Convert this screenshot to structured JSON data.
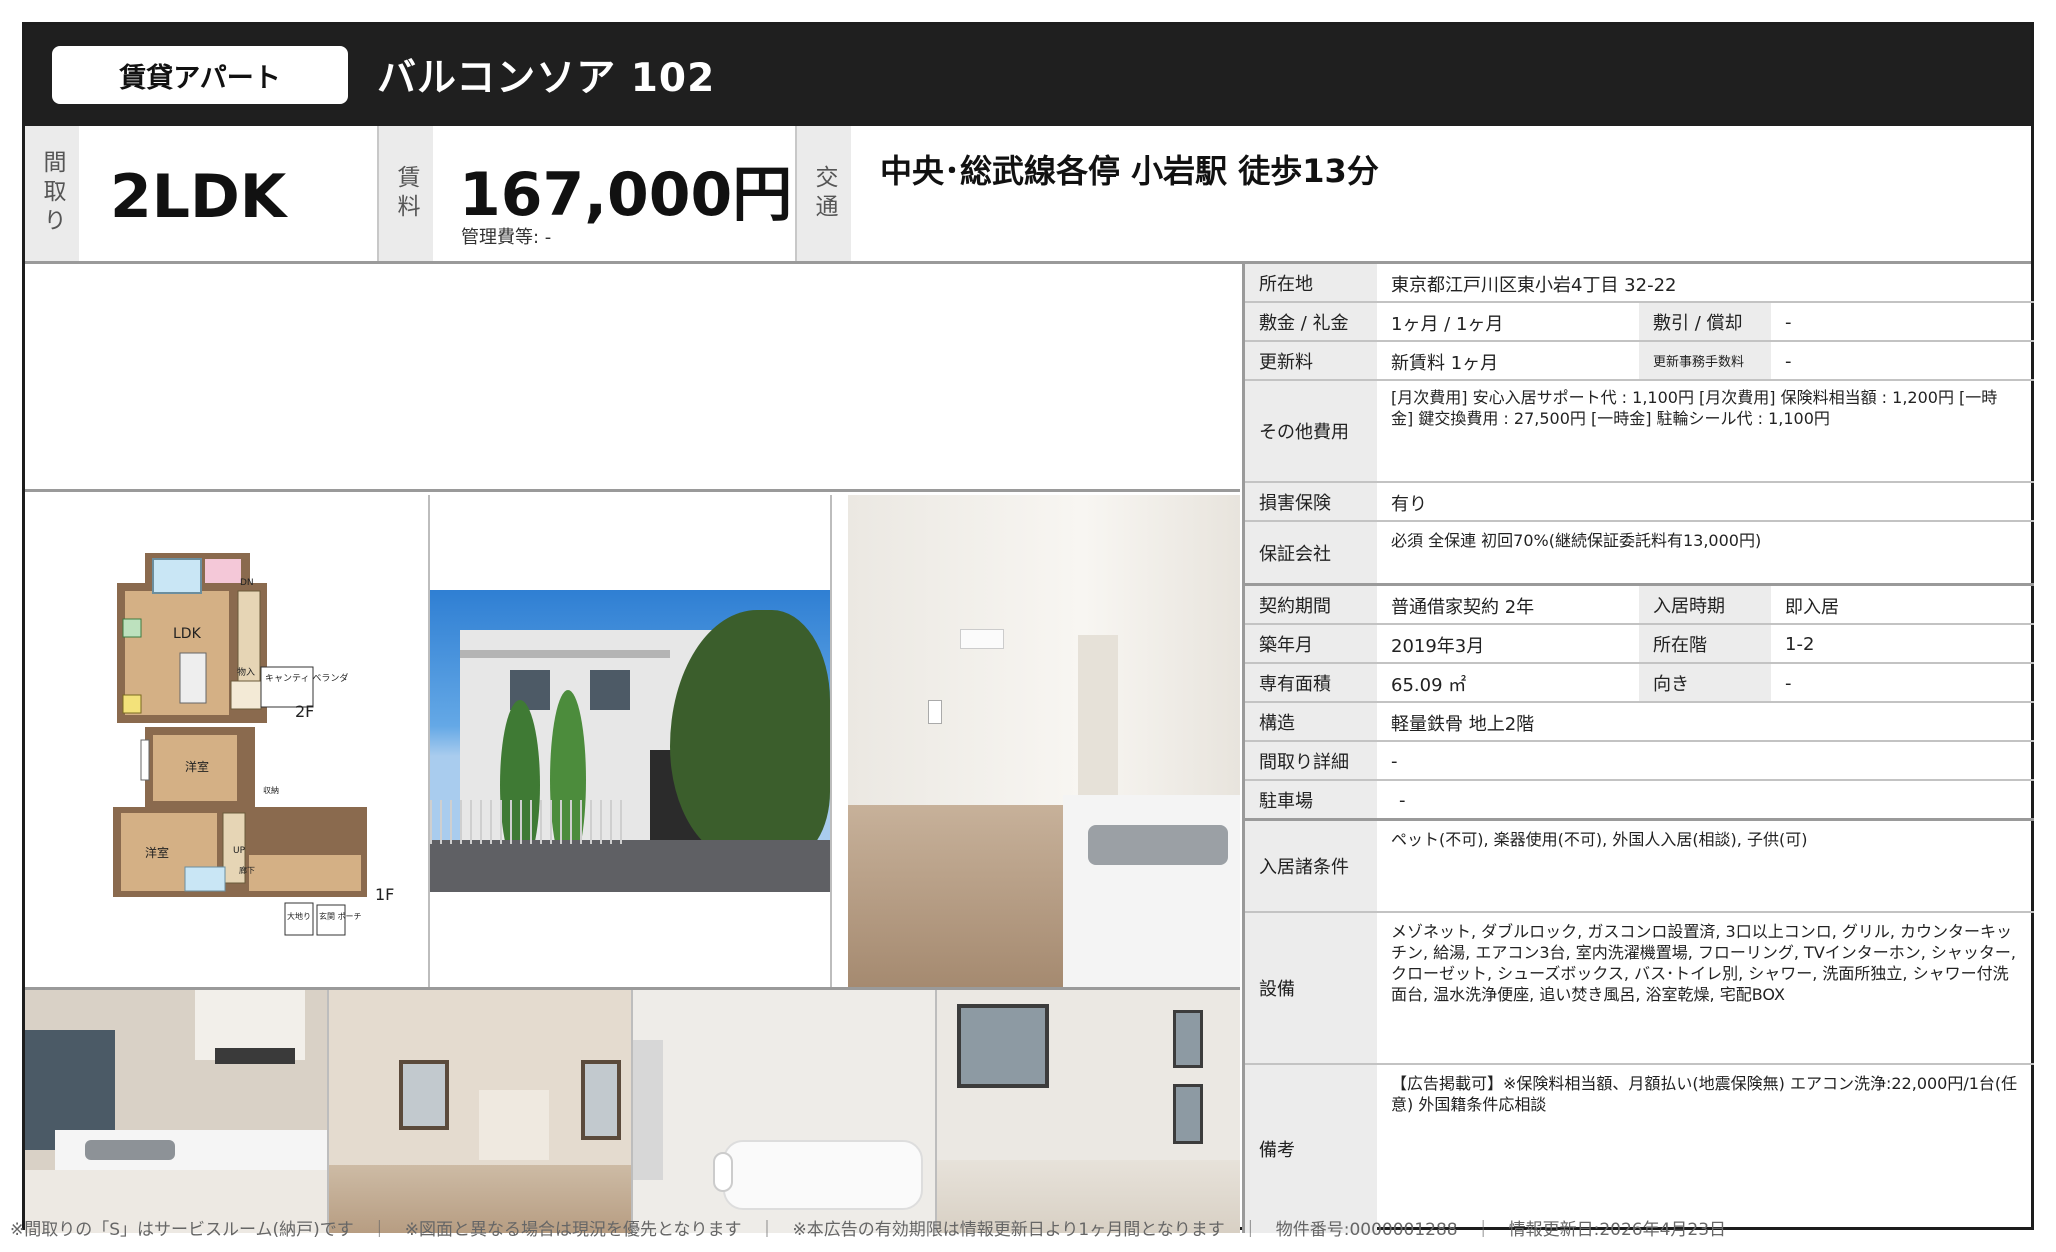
{
  "header": {
    "property_type": "賃貸アパート",
    "property_name": "バルコンソア 102"
  },
  "key_info": {
    "layout_label": "間取り",
    "layout_value": "2LDK",
    "rent_label": "賃料",
    "rent_value": "167,000円",
    "management_fee": "管理費等: -",
    "access_label": "交通",
    "access_value": "中央･総武線各停 小岩駅 徒歩13分"
  },
  "floor_plan": {
    "ldk": "LDK",
    "room_1": "洋室",
    "room_2": "洋室",
    "floor_2": "2F",
    "floor_1": "1F",
    "balcony": "キャンティ ベランダ",
    "storage": "物入",
    "closet": "収納",
    "hall": "廊下",
    "up": "UP",
    "dn": "DN",
    "entrance": "玄関 ポーチ",
    "porch": "大地り"
  },
  "details": {
    "address_label": "所在地",
    "address_value": "東京都江戸川区東小岩4丁目 32-22",
    "deposit_label": "敷金 / 礼金",
    "deposit_value": "1ヶ月 / 1ヶ月",
    "deduction_label": "敷引 / 償却",
    "deduction_value": "-",
    "renewal_label": "更新料",
    "renewal_value": "新賃料 1ヶ月",
    "renewal_fee_label": "更新事務手数料",
    "renewal_fee_value": "-",
    "other_fees_label": "その他費用",
    "other_fees_value": "[月次費用] 安心入居サポート代 : 1,100円 [月次費用] 保険料相当額 : 1,200円 [一時金] 鍵交換費用 : 27,500円 [一時金] 駐輪シール代 : 1,100円",
    "insurance_label": "損害保険",
    "insurance_value": "有り",
    "guarantor_label": "保証会社",
    "guarantor_value": "必須 全保連 初回70%(継続保証委託料有13,000円)",
    "contract_label": "契約期間",
    "contract_value": "普通借家契約 2年",
    "move_in_label": "入居時期",
    "move_in_value": "即入居",
    "built_label": "築年月",
    "built_value": "2019年3月",
    "floor_label": "所在階",
    "floor_value": "1-2",
    "area_label": "専有面積",
    "area_value": "65.09 ㎡",
    "direction_label": "向き",
    "direction_value": "-",
    "structure_label": "構造",
    "structure_value": "軽量鉄骨 地上2階",
    "layout_detail_label": "間取り詳細",
    "layout_detail_value": "-",
    "parking_label": "駐車場",
    "parking_value": "-",
    "conditions_label": "入居諸条件",
    "conditions_value": "ペット(不可), 楽器使用(不可), 外国人入居(相談), 子供(可)",
    "equipment_label": "設備",
    "equipment_value": "メゾネット, ダブルロック, ガスコンロ設置済, 3口以上コンロ, グリル, カウンターキッチン, 給湯, エアコン3台, 室内洗濯機置場, フローリング, TVインターホン, シャッター, クローゼット, シューズボックス, バス･トイレ別, シャワー, 洗面所独立, シャワー付洗面台, 温水洗浄便座, 追い焚き風呂, 浴室乾燥, 宅配BOX",
    "remarks_label": "備考",
    "remarks_value": "【広告掲載可】※保険料相当額、月額払い(地震保険無) エアコン洗浄:22,000円/1台(任意) 外国籍条件応相談"
  },
  "footer": {
    "text": "※間取りの「S」はサービスルーム(納戸)です　｜　※図面と異なる場合は現況を優先となります　｜　※本広告の有効期限は情報更新日より1ヶ月間となります　｜　物件番号:0000001288　｜　情報更新日:2026年4月23日"
  }
}
